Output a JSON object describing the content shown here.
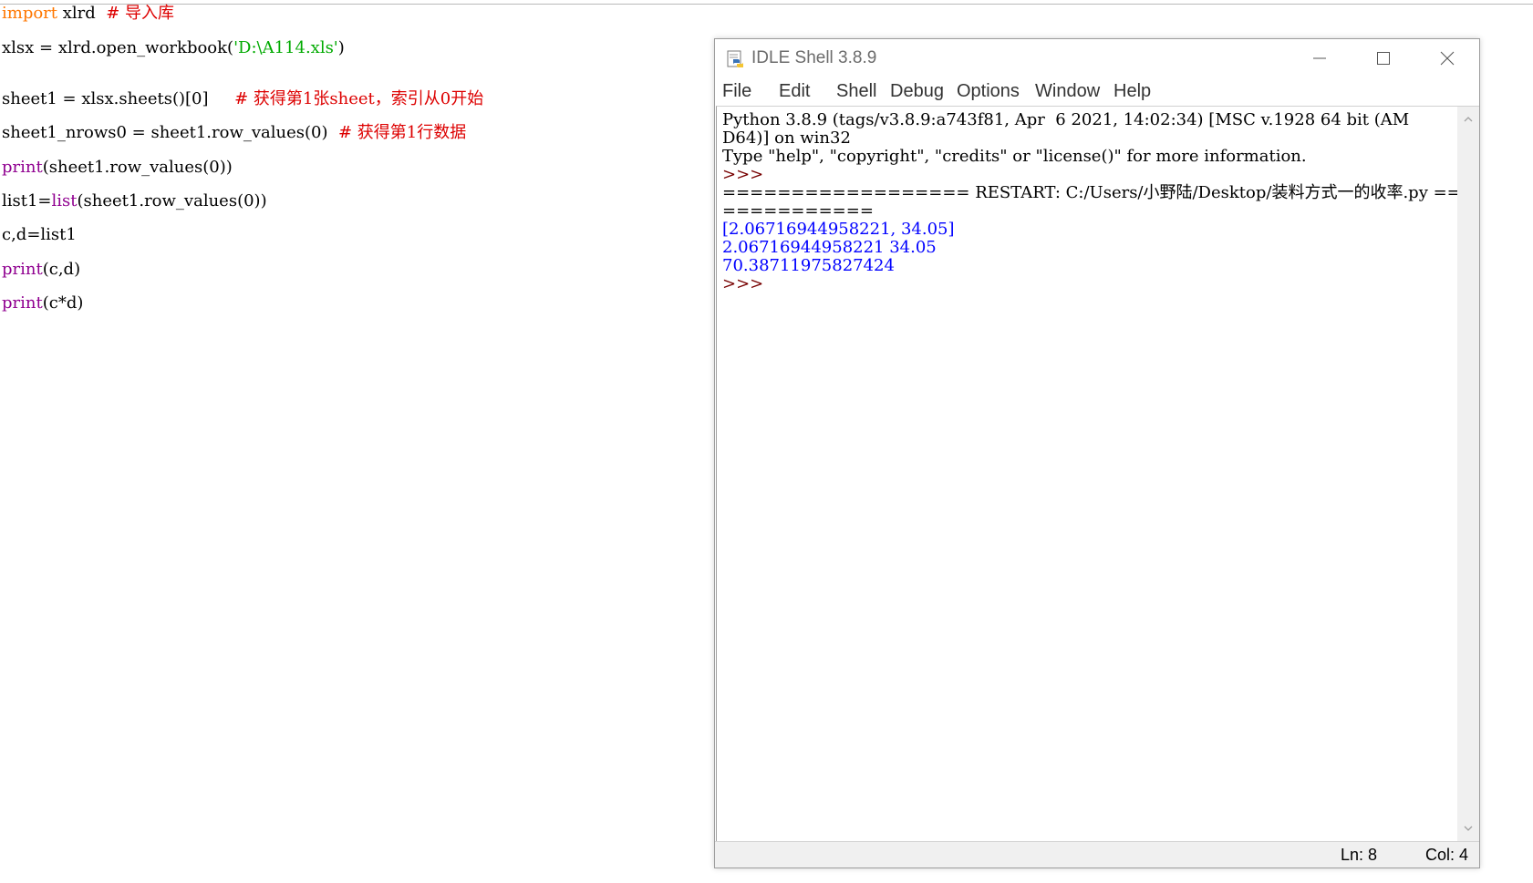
{
  "editor": {
    "line1": {
      "keyword": "import",
      "rest": " xlrd  ",
      "comment": "# 导入库"
    },
    "line2": {
      "pre": "xlsx = xlrd.open_workbook(",
      "string": "'D:\\A114.xls'",
      "post": ")"
    },
    "line3": {
      "code": "sheet1 = xlsx.sheets()[0]     ",
      "comment": "# 获得第1张sheet，索引从0开始"
    },
    "line4": {
      "code": "sheet1_nrows0 = sheet1.row_values(0)  ",
      "comment": "# 获得第1行数据"
    },
    "line5": {
      "builtin": "print",
      "rest": "(sheet1.row_values(0))"
    },
    "line6": {
      "pre": "list1=",
      "builtin": "list",
      "rest": "(sheet1.row_values(0))"
    },
    "line7": {
      "code": "c,d=list1"
    },
    "line8": {
      "builtin": "print",
      "rest": "(c,d)"
    },
    "line9": {
      "builtin": "print",
      "rest": "(c*d)"
    }
  },
  "shell": {
    "title": "IDLE Shell 3.8.9",
    "icon": "python-idle-icon",
    "menu": [
      "File",
      "Edit",
      "Shell",
      "Debug",
      "Options",
      "Window",
      "Help"
    ],
    "lines": [
      "Python 3.8.9 (tags/v3.8.9:a743f81, Apr  6 2021, 14:02:34) [MSC v.1928 64 bit (AM",
      "D64)] on win32",
      "Type \"help\", \"copyright\", \"credits\" or \"license()\" for more information.",
      ">>> ",
      "================== RESTART: C:/Users/小野陆/Desktop/装料方式一的收率.py =======",
      "===========",
      "[2.06716944958221, 34.05]",
      "2.06716944958221 34.05",
      "70.38711975827424",
      ">>> "
    ],
    "status": {
      "ln": "Ln: 8",
      "col": "Col: 4"
    }
  },
  "colors": {
    "keyword": "#ff7700",
    "builtin": "#900090",
    "comment": "#dd0000",
    "string": "#00aa00",
    "output": "#0000ff",
    "prompt": "#770000"
  }
}
